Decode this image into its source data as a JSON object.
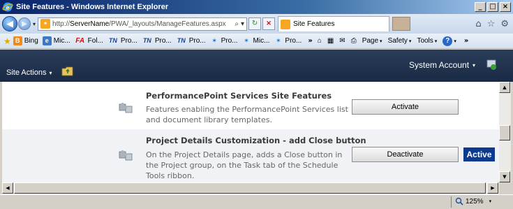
{
  "window": {
    "title": "Site Features - Windows Internet Explorer",
    "minimize_glyph": "_",
    "maximize_glyph": "□",
    "close_glyph": "×"
  },
  "address_bar": {
    "url_prefix": "http://",
    "url_host": "ServerName",
    "url_path": "/PWA/_layouts/ManageFeatures.aspx",
    "search_glyph": "⌕",
    "dropdown_glyph": "▾",
    "refresh_glyph": "↻",
    "stop_glyph": "×"
  },
  "tab": {
    "label": "Site Features"
  },
  "nav": {
    "back_glyph": "◀",
    "forward_glyph": "▶",
    "dropdown_glyph": "▾",
    "home_glyph": "⌂",
    "favorites_glyph": "☆",
    "settings_glyph": "⚙"
  },
  "favorites_bar": {
    "star_glyph": "★",
    "items": [
      {
        "label": "Bing",
        "icon": "B"
      },
      {
        "label": "Mic...",
        "icon": "e"
      },
      {
        "label": "Fol...",
        "icon": "FA"
      },
      {
        "label": "Pro...",
        "icon": "TN"
      },
      {
        "label": "Pro...",
        "icon": "TN"
      },
      {
        "label": "Pro...",
        "icon": "TN"
      },
      {
        "label": "Pro...",
        "icon": "✶"
      },
      {
        "label": "Mic...",
        "icon": "✶"
      },
      {
        "label": "Pro...",
        "icon": "✶"
      }
    ],
    "more_glyph": "»"
  },
  "command_bar": {
    "home_glyph": "⌂",
    "feeds_glyph": "▦",
    "mail_glyph": "✉",
    "print_glyph": "⎙",
    "page_label": "Page",
    "safety_label": "Safety",
    "tools_label": "Tools",
    "help_glyph": "?",
    "caret_glyph": "▾",
    "more_glyph": "»"
  },
  "sharepoint_bar": {
    "site_actions_label": "Site Actions",
    "caret_glyph": "▾",
    "account_label": "System Account"
  },
  "features": [
    {
      "name": "PerformancePoint Services Site Features",
      "description": "Features enabling the PerformancePoint Services list and document library templates.",
      "button_label": "Activate",
      "status": ""
    },
    {
      "name": "Project Details Customization - add Close button",
      "description": "On the Project Details page, adds a Close button in the Project group, on the Task tab of the Schedule Tools ribbon.",
      "button_label": "Deactivate",
      "status": "Active"
    }
  ],
  "scrollbars": {
    "up_glyph": "▲",
    "down_glyph": "▼",
    "left_glyph": "◀",
    "right_glyph": "▶"
  },
  "status_bar": {
    "zoom_label": "125%",
    "caret_glyph": "▾"
  },
  "colors": {
    "title_bar": "#0a246a",
    "sharepoint_bar": "#1a2a44",
    "active_badge": "#0b3a8f"
  }
}
